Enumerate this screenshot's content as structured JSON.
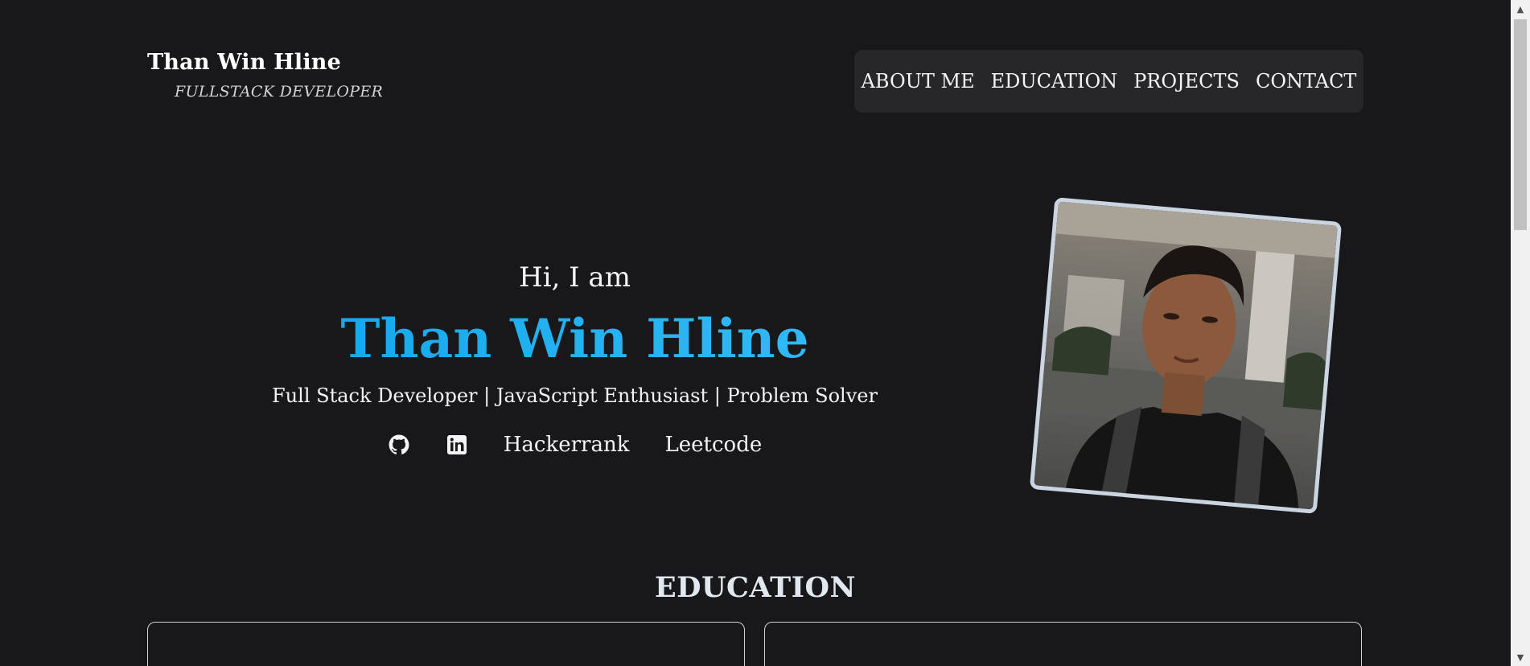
{
  "header": {
    "brand_name": "Than Win Hline",
    "brand_subtitle": "FULLSTACK DEVELOPER",
    "nav": [
      "ABOUT ME",
      "EDUCATION",
      "PROJECTS",
      "CONTACT"
    ]
  },
  "hero": {
    "greeting": "Hi, I am",
    "name": "Than Win Hline",
    "tagline": "Full Stack Developer | JavaScript Enthusiast | Problem Solver",
    "links": {
      "github_icon": "github-icon",
      "linkedin_icon": "linkedin-icon",
      "hackerrank": "Hackerrank",
      "leetcode": "Leetcode"
    }
  },
  "education": {
    "title": "EDUCATION"
  },
  "colors": {
    "background": "#18181b",
    "nav_background": "#27272a",
    "accent": "#0ea5e9",
    "photo_border": "#cbd5e1"
  }
}
